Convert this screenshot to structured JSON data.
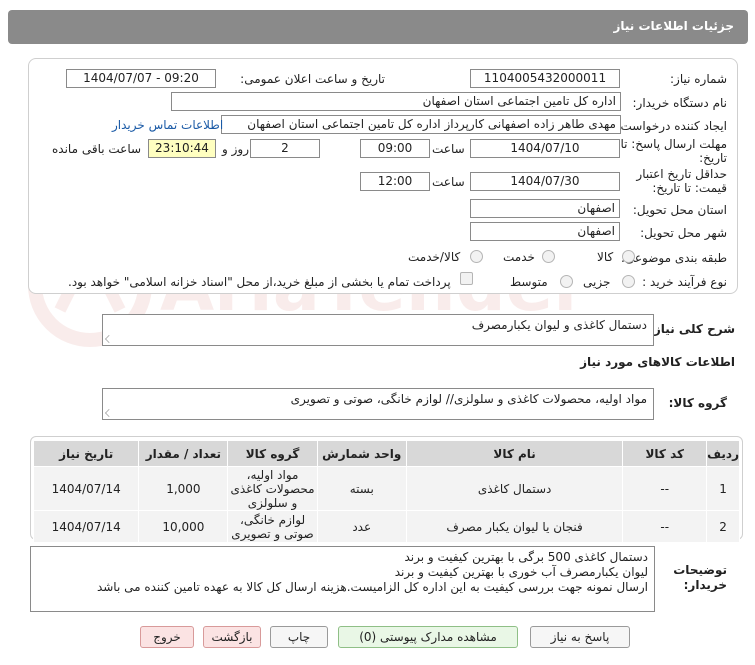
{
  "header": {
    "title": "جزئیات اطلاعات نیاز"
  },
  "form": {
    "need_number_label": "شماره نیاز:",
    "need_number": "1104005432000011",
    "announce_label": "تاریخ و ساعت اعلان عمومی:",
    "announce_value": "1404/07/07 - 09:20",
    "buyer_org_label": "نام دستگاه خریدار:",
    "buyer_org": "اداره کل تامین اجتماعی استان اصفهان",
    "creator_label": "ایجاد کننده درخواست:",
    "creator": "مهدی طاهر زاده اصفهانی کارپرداز اداره کل تامین اجتماعی استان اصفهان",
    "contact_link": "اطلاعات تماس خریدار",
    "deadline_label_1": "مهلت ارسال پاسخ: تا",
    "deadline_label_2": "تاریخ:",
    "deadline_date": "1404/07/10",
    "time_label": "ساعت",
    "deadline_time": "09:00",
    "days_value": "2",
    "days_label": "روز و",
    "remaining_time": "23:10:44",
    "remaining_label": "ساعت باقی مانده",
    "min_price_label_1": "حداقل تاریخ اعتبار",
    "min_price_label_2": "قیمت: تا تاریخ:",
    "min_price_date": "1404/07/30",
    "min_price_time_label": "ساعت",
    "min_price_time": "12:00",
    "province_label": "استان محل تحویل:",
    "province": "اصفهان",
    "city_label": "شهر محل تحویل:",
    "city": "اصفهان",
    "category_label": "طبقه بندی موضوعی:",
    "category_options": [
      "کالا",
      "خدمت",
      "کالا/خدمت"
    ],
    "process_label": "نوع فرآیند خرید :",
    "process_options": [
      "جزیی",
      "متوسط"
    ],
    "payment_note": "پرداخت تمام یا بخشی از مبلغ خرید،از محل \"اسناد خزانه اسلامی\" خواهد بود."
  },
  "summary": {
    "label": "شرح کلی نیاز:",
    "value": "دستمال کاغذی و لیوان یکبارمصرف"
  },
  "goods_info_title": "اطلاعات کالاهای مورد نیاز",
  "goods_group": {
    "label": "گروه کالا:",
    "value": "مواد اولیه، محصولات کاغذی و سلولزی// لوازم خانگی، صوتی و تصویری"
  },
  "table": {
    "headers": [
      "ردیف",
      "کد کالا",
      "نام کالا",
      "واحد شمارش",
      "گروه کالا",
      "تعداد / مقدار",
      "تاریخ نیاز"
    ],
    "rows": [
      [
        "1",
        "--",
        "دستمال کاغذی",
        "بسته",
        "مواد اولیه، محصولات کاغذی و سلولزی",
        "1,000",
        "1404/07/14"
      ],
      [
        "2",
        "--",
        "فنجان یا لیوان یکبار مصرف",
        "عدد",
        "لوازم خانگی، صوتی و تصویری",
        "10,000",
        "1404/07/14"
      ]
    ]
  },
  "buyer_notes": {
    "label_1": "توضیحات",
    "label_2": "خریدار:",
    "line1": "دستمال کاغذی 500 برگی با بهترین کیفیت و برند",
    "line2": "لیوان یکبارمصرف آب خوری با بهترین کیفیت و برند",
    "line3": "ارسال نمونه جهت بررسی کیفیت به این اداره کل الزامیست.هزینه ارسال کل کالا به عهده تامین کننده می باشد"
  },
  "buttons": {
    "reply": "پاسخ به نیاز",
    "attachments": "مشاهده مدارک پیوستی (0)",
    "print": "چاپ",
    "back": "بازگشت",
    "exit": "خروج"
  },
  "watermark": {
    "text": "AriaTender.neT"
  }
}
